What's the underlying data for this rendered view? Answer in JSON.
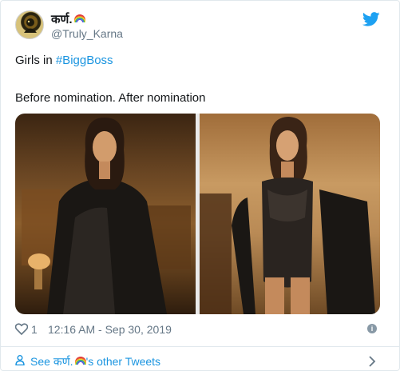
{
  "author": {
    "display_name": "कर्ण.",
    "handle": "@Truly_Karna",
    "avatar_icon": "avatar-icon",
    "name_emoji_icon": "rainbow-icon"
  },
  "brand": {
    "icon": "twitter-bird-icon",
    "color": "#1da1f2"
  },
  "tweet": {
    "text_prefix": "Girls in ",
    "hashtag": "#BiggBoss",
    "caption": "Before nomination.  After nomination",
    "hashtag_color": "#1b95e0"
  },
  "media": {
    "left_photo": "photo-before-nomination",
    "right_photo": "photo-after-nomination"
  },
  "footer": {
    "like_icon": "heart-icon",
    "likes": "1",
    "timestamp": "12:16 AM - Sep 30, 2019",
    "info_icon": "info-icon"
  },
  "see_more": {
    "prefix": "See ",
    "name": "कर्ण.",
    "suffix": "'s other Tweets",
    "icon": "person-icon",
    "chevron": "chevron-right-icon"
  }
}
